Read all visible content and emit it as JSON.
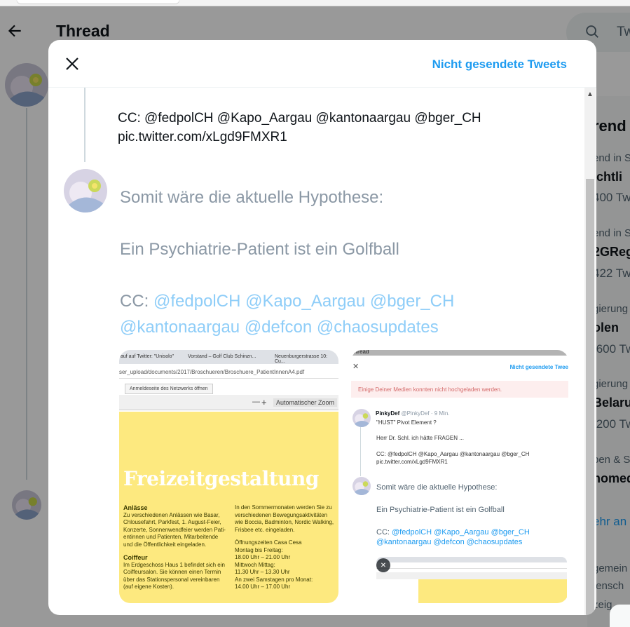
{
  "background": {
    "header": {
      "title": "Thread",
      "search_placeholder": "Tw"
    },
    "trends": {
      "heading": "rend",
      "items": [
        {
          "category": "end in S",
          "name": "ichtli",
          "count": "400 Tw"
        },
        {
          "category": "end in S",
          "name": "2GReg",
          "count": "422 Tw"
        },
        {
          "category": "gierung",
          "name": "olen",
          "count": ".600 Tw"
        },
        {
          "category": "gierung",
          "name": "Belaru",
          "count": ".200 Tw"
        },
        {
          "category": "pen & S",
          "name": "nomed",
          "count": ""
        }
      ],
      "more_link": "ehr an",
      "footer_lines": [
        "gemein",
        "tensch",
        "zeig"
      ]
    }
  },
  "modal": {
    "unsent_tweets_label": "Nicht gesendete Tweets",
    "previous_tweet": {
      "line1": "CC: @fedpolCH @Kapo_Aargau @kantonaargau @bger_CH",
      "line2": "pic.twitter.com/xLgd9FMXR1"
    },
    "draft": {
      "paragraph1": "Somit wäre die aktuelle Hypothese:",
      "paragraph2": "Ein Psychiatrie-Patient ist ein Golfball",
      "cc_prefix": "CC: ",
      "mentions_line1": "@fedpolCH @Kapo_Aargau @bger_CH",
      "mentions_line2": "@kantonaargau @defcon @chaosupdates"
    },
    "media1": {
      "tabs": [
        "auf auf Twitter: \"Unisolo\"",
        "Vorstand – Golf Club Schinzn...",
        "Neuenburgerstrasse 10: Cu..."
      ],
      "url": "ser_upload/documents/2017/Broschueren/Broschuere_PatientInnenA4.pdf",
      "network_button": "Anmeldeseite des Netzwerks öffnen",
      "zoom_label": "Automatischer Zoom",
      "minus": "—",
      "plus": "+",
      "hero_title": "Freizeitgestaltung",
      "left_heading1": "Anlässe",
      "left_text1": "Zu verschiedenen Anlässen wie Basar, Chlousefahrt, Parkfest, 1. August-Feier, Konzerte, Sonnenwendfeier werden Pati-entinnen und Patienten, Mitarbeitende und die Öffentlichkeit eingeladen.",
      "left_heading2": "Coiffeur",
      "left_text2": "Im Erdgeschoss Haus 1 befindet sich ein Coiffeursalon. Sie können einen Termin über das Stationspersonal vereinbaren (auf eigene Kosten).",
      "right_text1": "In den Sommermonaten werden Sie zu verschiedenen Bewegungsaktivitäten wie Boccia, Badminton, Nordic Walking, Frisbee etc. eingeladen.",
      "right_text2": "Öffnungszeiten Casa Cesa",
      "right_text3": "Montag bis Freitag:",
      "right_text4": "18.00 Uhr – 21.00 Uhr",
      "right_text5": "Mittwoch Mittag:",
      "right_text6": "11.30 Uhr – 13.30 Uhr",
      "right_text7": "An zwei Samstagen pro Monat:",
      "right_text8": "14.00 Uhr – 17.00 Uhr"
    },
    "media2": {
      "top_label": "hread",
      "unsent_label": "Nicht gesendete Twee",
      "error": "Einige Deiner Medien konnten nicht hochgeladen werden.",
      "author_name": "PinkyDef",
      "author_handle": "@PinkyDef · 9 Min.",
      "line1": "\"HUST\" Pivot Element ?",
      "line2": "Herr Dr. Schl. ich hätte FRAGEN ...",
      "line3": "CC: @fedpolCH @Kapo_Aargau @kantonaargau @bger_CH",
      "line4": "pic.twitter.com/xLgd9FMXR1",
      "draft1": "Somit wäre die aktuelle Hypothese:",
      "draft2": "Ein Psychiatrie-Patient ist ein Golfball",
      "draft3_prefix": "CC: ",
      "draft3_mentions": "@fedpolCH @Kapo_Aargau @bger_CH",
      "draft4": "@kantonaargau @defcon @chaosupdates"
    }
  }
}
